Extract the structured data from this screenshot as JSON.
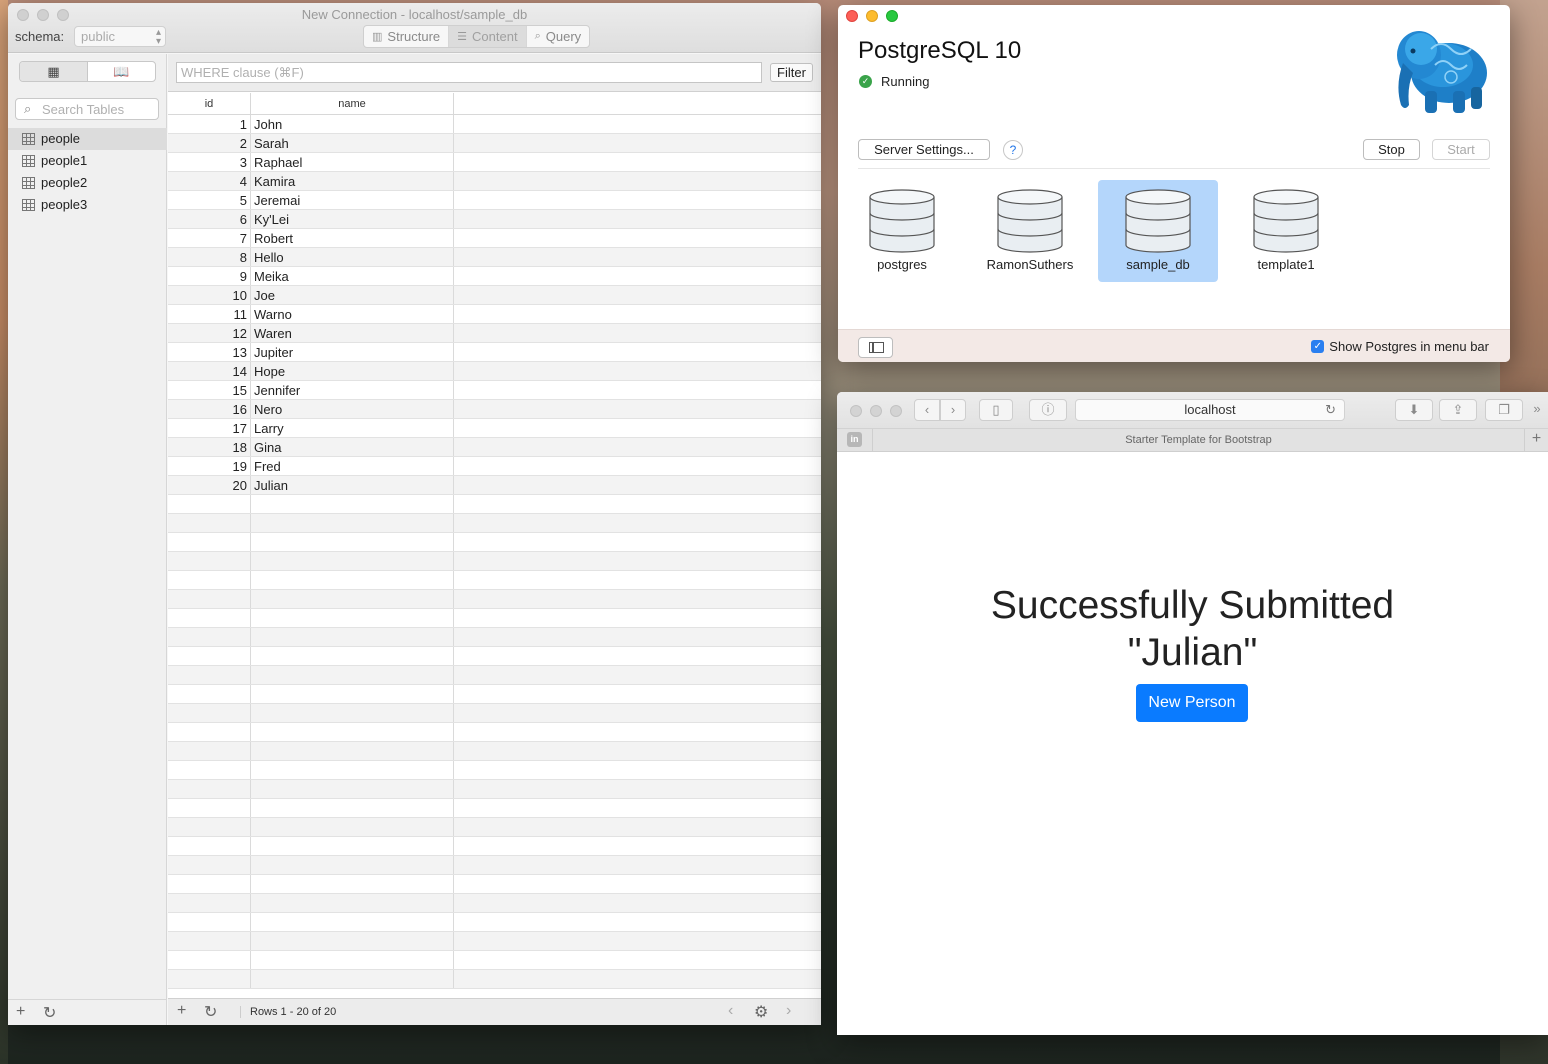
{
  "sequel_pro": {
    "window_title": "New Connection - localhost/sample_db",
    "schema_label": "schema:",
    "schema_value": "public",
    "tabs": [
      {
        "label": "Structure",
        "icon": "structure-icon",
        "active": false
      },
      {
        "label": "Content",
        "icon": "content-icon",
        "active": true
      },
      {
        "label": "Query",
        "icon": "query-icon",
        "active": false
      }
    ],
    "search_placeholder": "Search Tables",
    "tables": [
      {
        "name": "people",
        "selected": true
      },
      {
        "name": "people1",
        "selected": false
      },
      {
        "name": "people2",
        "selected": false
      },
      {
        "name": "people3",
        "selected": false
      }
    ],
    "where_placeholder": "WHERE clause (⌘F)",
    "filter_label": "Filter",
    "columns": [
      "id",
      "name"
    ],
    "rows": [
      {
        "id": "1",
        "name": "John"
      },
      {
        "id": "2",
        "name": "Sarah"
      },
      {
        "id": "3",
        "name": "Raphael"
      },
      {
        "id": "4",
        "name": "Kamira"
      },
      {
        "id": "5",
        "name": "Jeremai"
      },
      {
        "id": "6",
        "name": "Ky'Lei"
      },
      {
        "id": "7",
        "name": "Robert"
      },
      {
        "id": "8",
        "name": "Hello"
      },
      {
        "id": "9",
        "name": "Meika"
      },
      {
        "id": "10",
        "name": "Joe"
      },
      {
        "id": "11",
        "name": "Warno"
      },
      {
        "id": "12",
        "name": "Waren"
      },
      {
        "id": "13",
        "name": "Jupiter"
      },
      {
        "id": "14",
        "name": "Hope"
      },
      {
        "id": "15",
        "name": "Jennifer"
      },
      {
        "id": "16",
        "name": "Nero"
      },
      {
        "id": "17",
        "name": "Larry"
      },
      {
        "id": "18",
        "name": "Gina"
      },
      {
        "id": "19",
        "name": "Fred"
      },
      {
        "id": "20",
        "name": "Julian"
      }
    ],
    "rows_count": "Rows 1 - 20 of 20"
  },
  "postgres_app": {
    "title": "PostgreSQL 10",
    "status": "Running",
    "server_settings_label": "Server Settings...",
    "help_label": "?",
    "stop_label": "Stop",
    "start_label": "Start",
    "databases": [
      {
        "name": "postgres",
        "selected": false
      },
      {
        "name": "RamonSuthers",
        "selected": false
      },
      {
        "name": "sample_db",
        "selected": true
      },
      {
        "name": "template1",
        "selected": false
      }
    ],
    "menu_bar_label": "Show Postgres in menu bar",
    "menu_bar_checked": true
  },
  "safari": {
    "url": "localhost",
    "tab_title": "Starter Template for Bootstrap",
    "heading_line1": "Successfully Submitted",
    "heading_line2": "\"Julian\"",
    "button_label": "New Person",
    "accent_color": "#0a7bff"
  }
}
